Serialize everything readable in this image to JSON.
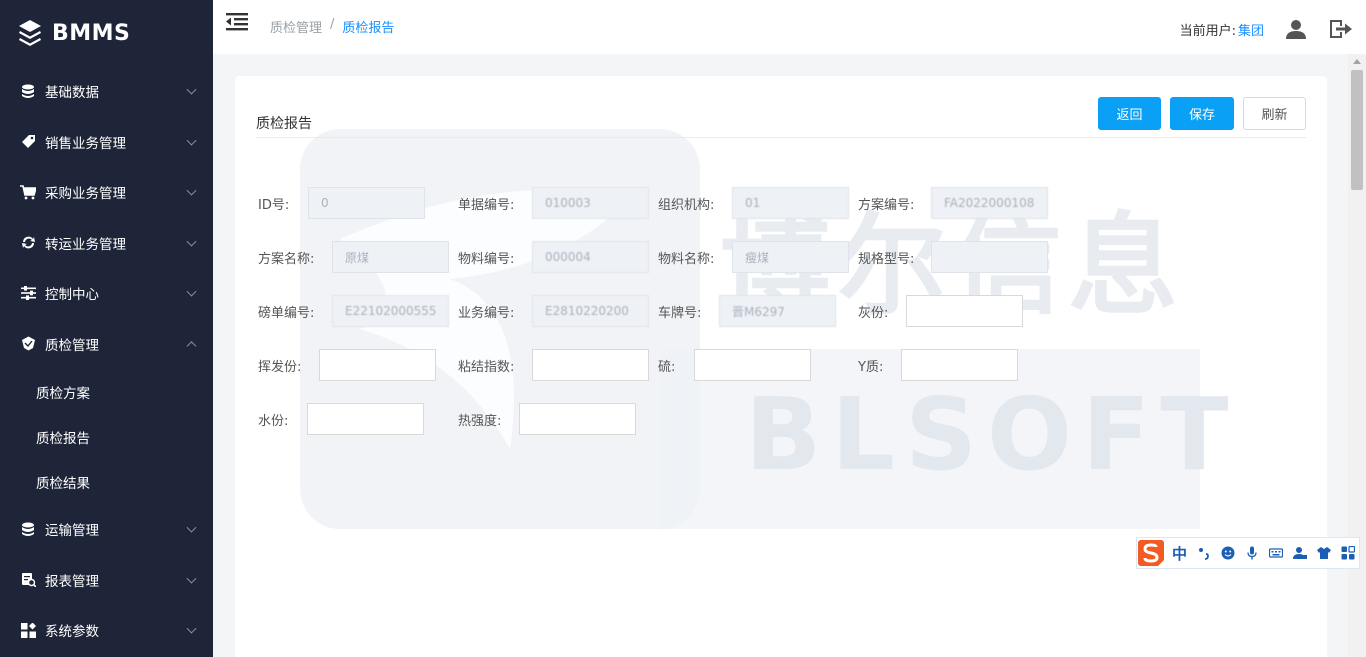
{
  "brand": {
    "name": "BMMS"
  },
  "sidebar": {
    "items": [
      {
        "label": "基础数据",
        "icon": "database-icon"
      },
      {
        "label": "销售业务管理",
        "icon": "tag-icon"
      },
      {
        "label": "采购业务管理",
        "icon": "cart-icon"
      },
      {
        "label": "转运业务管理",
        "icon": "transfer-icon"
      },
      {
        "label": "控制中心",
        "icon": "sliders-icon"
      },
      {
        "label": "质检管理",
        "icon": "inspection-icon",
        "expanded": true,
        "children": [
          "质检方案",
          "质检报告",
          "质检结果"
        ]
      },
      {
        "label": "运输管理",
        "icon": "database-icon"
      },
      {
        "label": "报表管理",
        "icon": "report-icon"
      },
      {
        "label": "系统参数",
        "icon": "grid-icon"
      }
    ]
  },
  "breadcrumb": {
    "parent": "质检管理",
    "separator": "/",
    "current": "质检报告"
  },
  "header": {
    "user_label": "当前用户:",
    "user_name": "集团"
  },
  "card": {
    "title": "质检报告",
    "buttons": {
      "back": "返回",
      "save": "保存",
      "refresh": "刷新"
    }
  },
  "form": {
    "id": {
      "label": "ID号:",
      "value": "0"
    },
    "doc_no": {
      "label": "单据编号:",
      "value": "010003"
    },
    "org": {
      "label": "组织机构:",
      "value": "01"
    },
    "scheme_no": {
      "label": "方案编号:",
      "value": "FA2022000108"
    },
    "scheme_name": {
      "label": "方案名称:",
      "value": "原煤"
    },
    "material_no": {
      "label": "物料编号:",
      "value": "000004"
    },
    "material_name": {
      "label": "物料名称:",
      "value": "瘦煤"
    },
    "spec": {
      "label": "规格型号:",
      "value": ""
    },
    "weigh_no": {
      "label": "磅单编号:",
      "value": "E22102000555"
    },
    "business_no": {
      "label": "业务编号:",
      "value": "E2810220200"
    },
    "plate": {
      "label": "车牌号:",
      "value": "晋M6297"
    },
    "ash": {
      "label": "灰份:",
      "value": ""
    },
    "volatile": {
      "label": "挥发份:",
      "value": ""
    },
    "caking": {
      "label": "粘结指数:",
      "value": ""
    },
    "sulfur": {
      "label": "硫:",
      "value": ""
    },
    "y": {
      "label": "Y质:",
      "value": ""
    },
    "moisture": {
      "label": "水份:",
      "value": ""
    },
    "thermal": {
      "label": "热强度:",
      "value": ""
    }
  },
  "watermark": {
    "text_cn": "博尔信息",
    "text_en": "BLSOFT"
  },
  "ime": {
    "mode": "中"
  },
  "colors": {
    "sidebar": "#1e2538",
    "accent": "#0aa0f6",
    "link": "#1890ff"
  }
}
